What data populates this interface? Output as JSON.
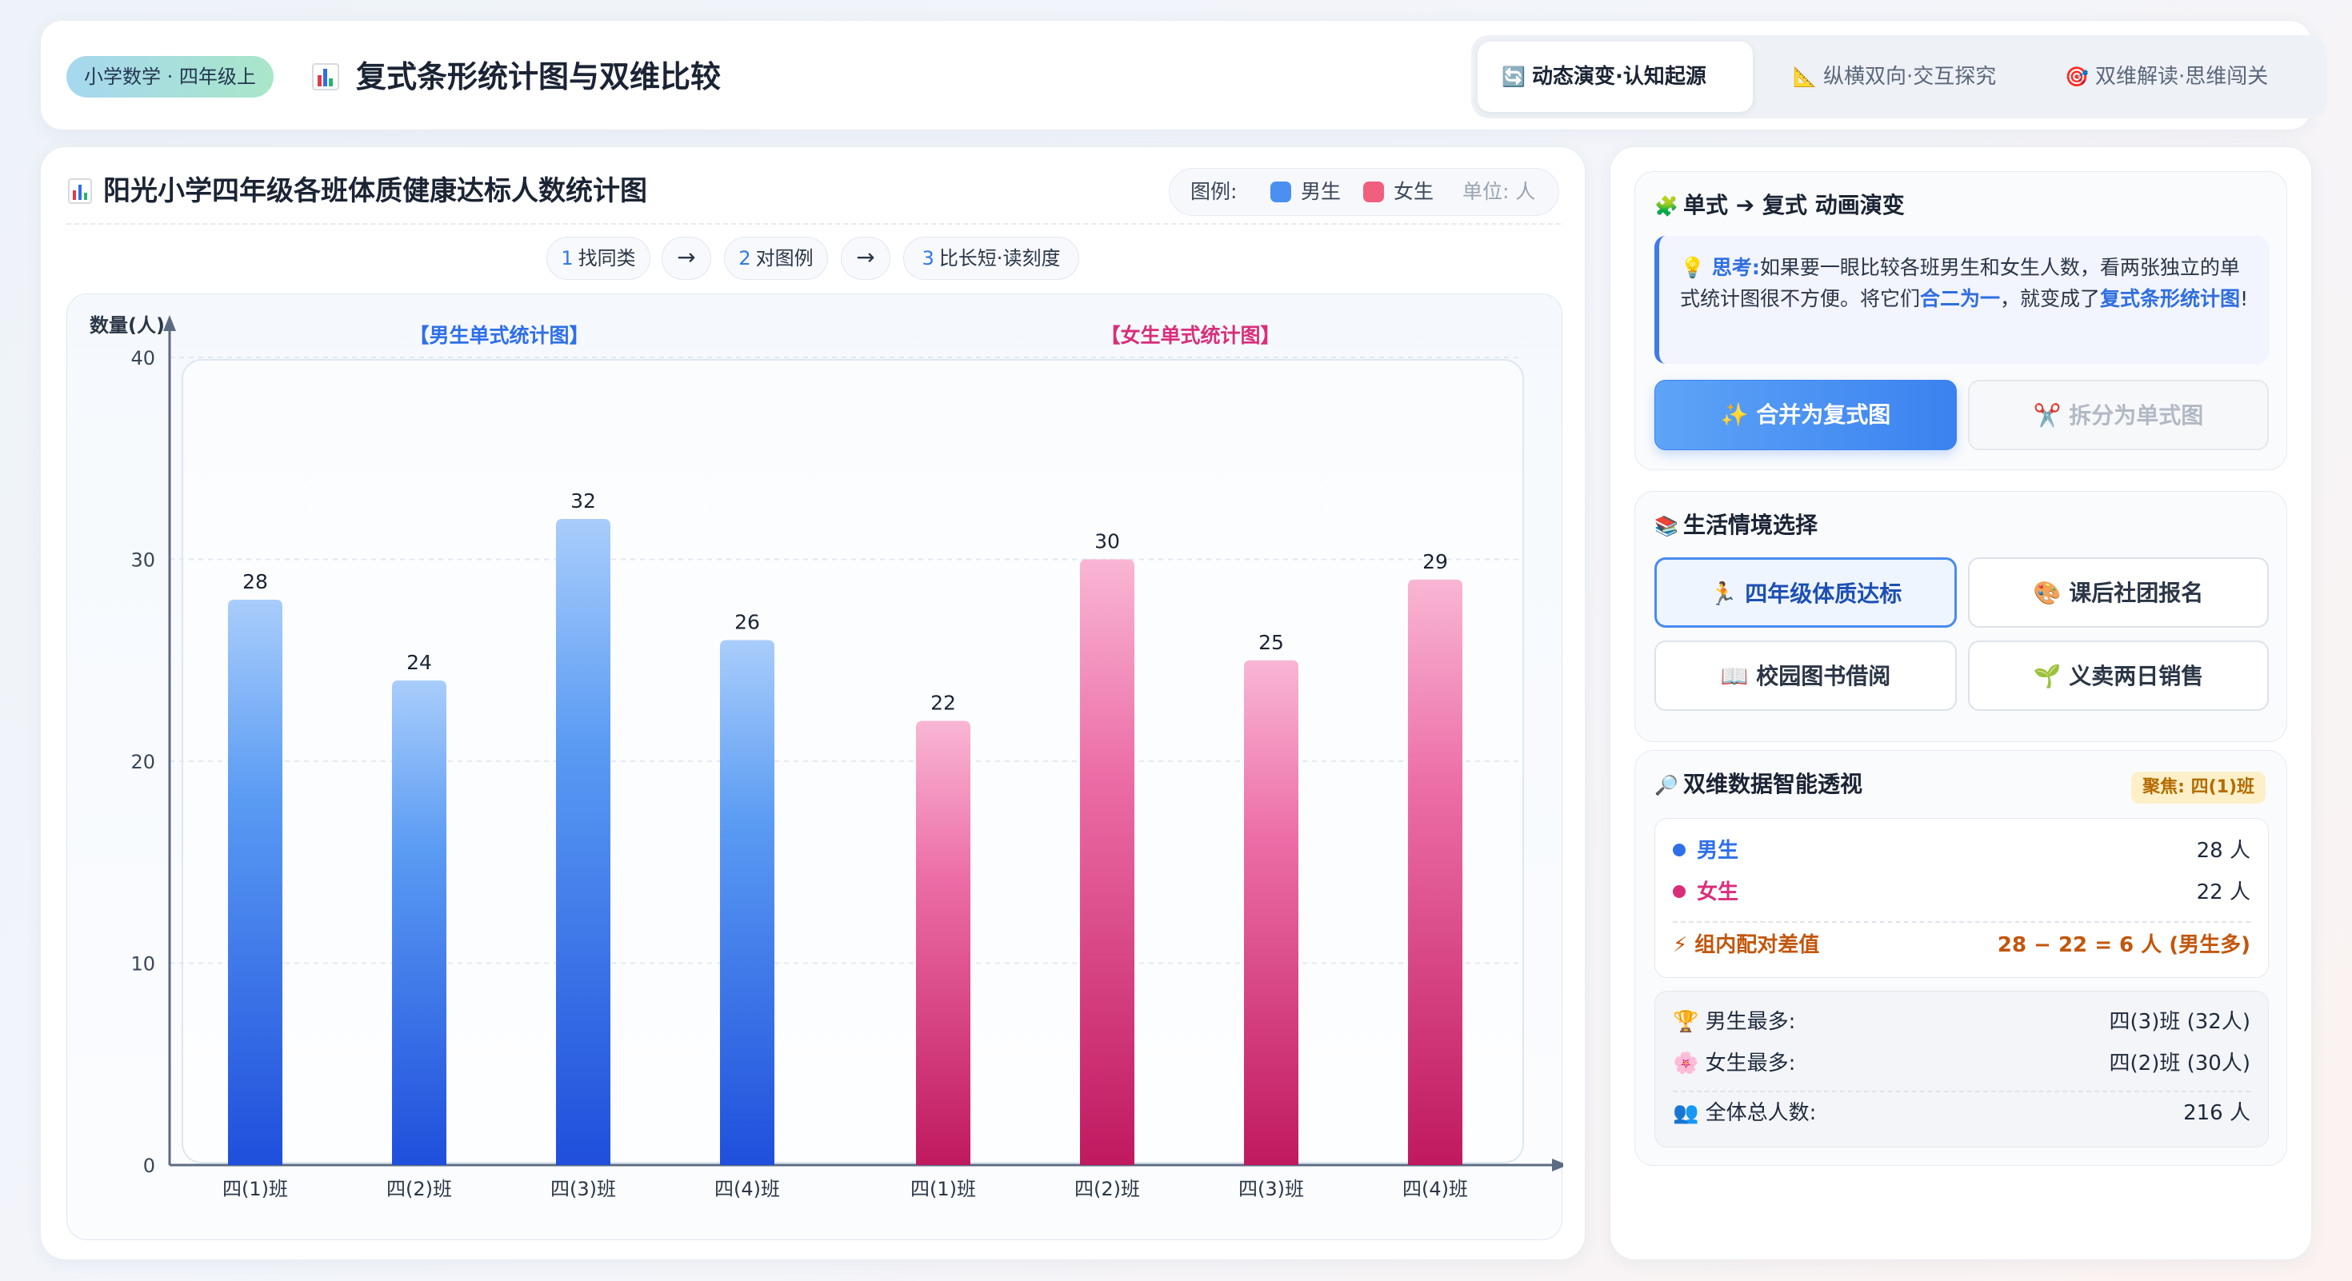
{
  "header": {
    "course": "小学数学 · 四年级上",
    "title": "复式条形统计图与双维比较",
    "tabs": [
      {
        "icon": "🔄",
        "label": "动态演变·认知起源",
        "active": true
      },
      {
        "icon": "📐",
        "label": "纵横双向·交互探究",
        "active": false
      },
      {
        "icon": "🎯",
        "label": "双维解读·思维闯关",
        "active": false
      }
    ]
  },
  "chart_card": {
    "title": "阳光小学四年级各班体质健康达标人数统计图",
    "legend": {
      "label": "图例:",
      "boys": "男生",
      "girls": "女生",
      "unit": "单位: 人"
    },
    "steps": [
      {
        "num": "1",
        "label": "找同类"
      },
      {
        "num": "2",
        "label": "对图例"
      },
      {
        "num": "3",
        "label": "比长短·读刻度"
      }
    ],
    "arrow": "→"
  },
  "chart_data": {
    "type": "bar",
    "ylabel": "数量(人)",
    "ylim": [
      0,
      40
    ],
    "yticks": [
      0,
      10,
      20,
      30,
      40
    ],
    "panels": [
      {
        "title": "【男生单式统计图】",
        "name": "男生",
        "color": "#2f6fe8",
        "categories": [
          "四(1)班",
          "四(2)班",
          "四(3)班",
          "四(4)班"
        ],
        "values": [
          28,
          24,
          32,
          26
        ]
      },
      {
        "title": "【女生单式统计图】",
        "name": "女生",
        "color": "#d92e7a",
        "categories": [
          "四(1)班",
          "四(2)班",
          "四(3)班",
          "四(4)班"
        ],
        "values": [
          22,
          30,
          25,
          29
        ]
      }
    ],
    "grid": true
  },
  "evolve": {
    "icon": "🧩",
    "title": "单式 ➔ 复式 动画演变",
    "think_prefix": "💡 思考:",
    "think_text_1": "如果要一眼比较各班男生和女生人数，看两张独立的单式统计图很不方便。将它们",
    "think_hl_1": "合二为一",
    "think_text_2": "，就变成了",
    "think_hl_2": "复式条形统计图",
    "think_text_3": "!",
    "merge_btn": "✨ 合并为复式图",
    "split_btn": "✂️ 拆分为单式图"
  },
  "scenes": {
    "icon": "📚",
    "title": "生活情境选择",
    "items": [
      {
        "label": "🏃 四年级体质达标",
        "active": true
      },
      {
        "label": "🎨 课后社团报名",
        "active": false
      },
      {
        "label": "📖 校园图书借阅",
        "active": false
      },
      {
        "label": "🌱 义卖两日销售",
        "active": false
      }
    ]
  },
  "insight": {
    "icon": "🔎",
    "title": "双维数据智能透视",
    "focus": "聚焦: 四(1)班",
    "boys_label": "男生",
    "boys_value": "28 人",
    "girls_label": "女生",
    "girls_value": "22 人",
    "diff_label": "⚡ 组内配对差值",
    "diff_value": "28 − 22 = 6 人 (男生多)",
    "boys_max_label": "🏆 男生最多:",
    "boys_max_value": "四(3)班 (32人)",
    "girls_max_label": "🌸 女生最多:",
    "girls_max_value": "四(2)班 (30人)",
    "total_label": "👥 全体总人数:",
    "total_value": "216 人",
    "colors": {
      "boys": "#2f6fe8",
      "girls": "#d92e7a",
      "diff": "#c2560c"
    }
  }
}
